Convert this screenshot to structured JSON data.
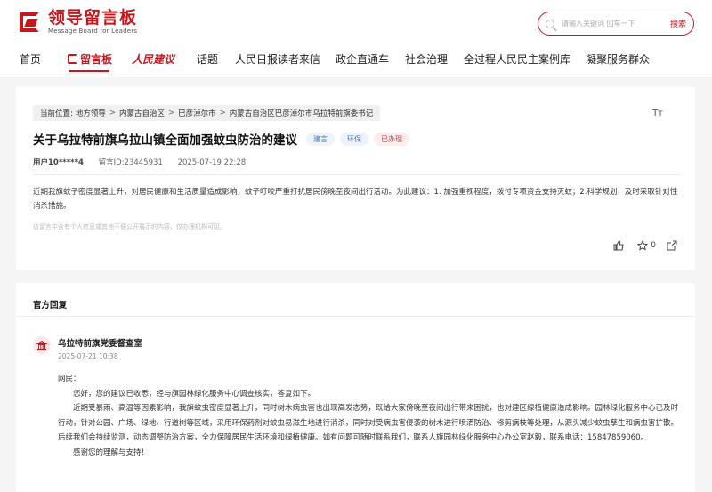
{
  "header": {
    "logo_cn": "领导留言板",
    "logo_en": "Message Board for Leaders",
    "search_placeholder": "请输入关键词 回车一下",
    "search_button": "搜索"
  },
  "nav": {
    "items": [
      "首页",
      "留言板",
      "人民建议",
      "话题",
      "人民日报读者来信",
      "政企直通车",
      "社会治理",
      "全过程人民民主案例库",
      "凝聚服务群众"
    ]
  },
  "breadcrumb": {
    "label": "当前位置:",
    "crumbs": [
      "地方领导",
      "内蒙古自治区",
      "巴彦淖尔市",
      "内蒙古自治区巴彦淖尔市乌拉特前旗委书记"
    ]
  },
  "message": {
    "title": "关于乌拉特前旗乌拉山镇全面加强蚊虫防治的建议",
    "tags": [
      "建言",
      "环保",
      "已办理"
    ],
    "user": "用户10*****4",
    "message_id": "留言ID:23445931",
    "datetime": "2025-07-19 22:28",
    "body": "近期我旗蚊子密度显著上升，对居民健康和生活质量造成影响，蚊子叮咬严重打扰居民傍晚至夜间出行活动。为此建议：1. 加强重视程度，拨付专项资金支持灭蚊；2.科学规划，及时采取针对性消杀措施。",
    "note": "该留言中含有个人信息或其他不便公开展示的内容，仅办理机构可见。",
    "font_toggle": "Tт",
    "likes": "",
    "favorites": "0"
  },
  "official": {
    "heading": "官方回复",
    "org_name": "乌拉特前旗党委督查室",
    "date": "2025-07-21 10:38",
    "greeting": "网民：",
    "p1": "您好，您的建议已收悉，经与旗园林绿化服务中心调查核实，答复如下。",
    "p2": "近期受暴雨、高温等因素影响，我旗蚊虫密度显著上升，同时树木病虫害也出现高发态势，既给大家傍晚至夜间出行带来困扰，也对建区绿植健康造成影响。园林绿化服务中心已及时行动，针对公园、广场、绿地、行道树等区域，采用环保药剂对蚊虫易滋生地进行消杀，同时对受病虫害侵袭的树木进行喷洒防治、修剪病枝等处理，从源头减少蚊虫孳生和病虫害扩散。后续我们会持续监测，动态调整防治方案，全力保障居民生活环境和绿植健康。如有问题可随时联系我们，联系人旗园林绿化服务中心办公室赵毅，联系电话：15847859060。",
    "p3": "感谢您的理解与支持！"
  },
  "colors": {
    "brand": "#c8161d",
    "tag_blue": "#4a78c2",
    "tag_red": "#d23b3b"
  }
}
